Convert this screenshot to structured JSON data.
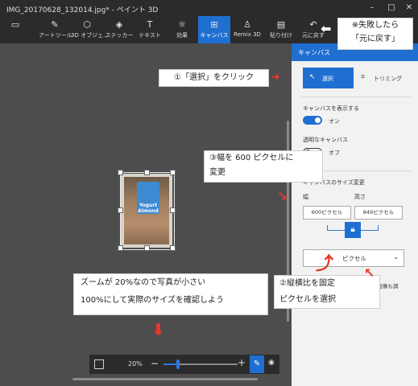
{
  "window": {
    "title": "IMG_20170628_132014.jpg* - ペイント 3D"
  },
  "toolbar": {
    "items": [
      {
        "label": "",
        "icon": "folder-icon"
      },
      {
        "label": "アートツール",
        "icon": "brush-icon"
      },
      {
        "label": "3D オブジェ...",
        "icon": "cube-icon"
      },
      {
        "label": "ステッカー",
        "icon": "sticker-icon"
      },
      {
        "label": "テキスト",
        "icon": "text-icon"
      },
      {
        "label": "効果",
        "icon": "effects-icon"
      },
      {
        "label": "キャンバス",
        "icon": "canvas-icon",
        "active": true
      },
      {
        "label": "Remix 3D",
        "icon": "remix-icon"
      },
      {
        "label": "貼り付け",
        "icon": "paste-icon"
      },
      {
        "label": "元に戻す",
        "icon": "undo-icon"
      }
    ]
  },
  "panel": {
    "title": "キャンバス",
    "select_label": "選択",
    "trim_label": "トリミング",
    "show_canvas_label": "キャンバスを表示する",
    "show_canvas_state": "オン",
    "transparent_label": "透明なキャンバス",
    "transparent_state": "オフ",
    "resize_title": "キャンバスのサイズ変更",
    "width_label": "幅",
    "height_label": "高さ",
    "width_value": "600ピクセル",
    "height_value": "849ピクセル",
    "unit_selected": "ピクセル",
    "resize_image_text": "、画像も調"
  },
  "zoom": {
    "value": "20%",
    "level_fraction": 0.2,
    "minus": "−",
    "plus": "+"
  },
  "annotations": {
    "undo_note_1": "※失敗したら",
    "undo_note_2": "「元に戻す」",
    "step1": "①「選択」をクリック",
    "step3_1": "③幅を 600 ピクセルに",
    "step3_2": "変更",
    "zoom_note_1": "ズームが 20%なので写真が小さい",
    "zoom_note_2": "100%にして実際のサイズを確認しよう",
    "step2_1": "②縦横比を固定",
    "step2_2": "ピクセルを選択"
  },
  "photo": {
    "label_text": "Yogurt Almond"
  },
  "colors": {
    "accent": "#1f6fd1",
    "annotation_red": "#e53a2e"
  }
}
